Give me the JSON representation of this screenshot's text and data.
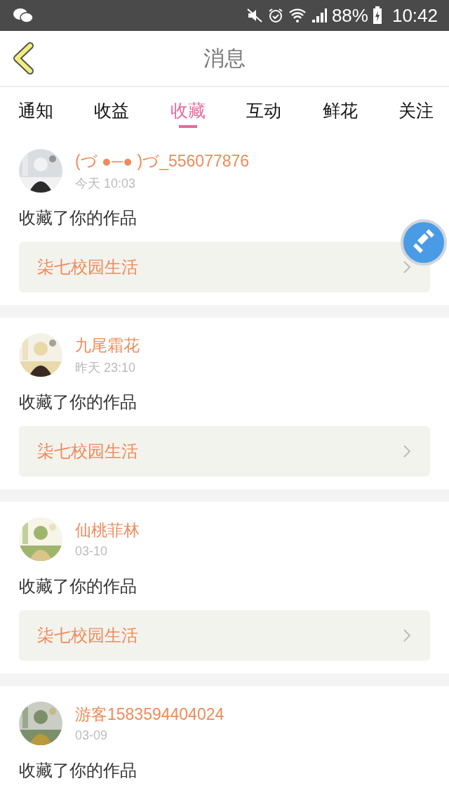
{
  "status_bar": {
    "battery": "88%",
    "time": "10:42"
  },
  "header": {
    "title": "消息"
  },
  "tabs": [
    {
      "label": "通知",
      "selected": false
    },
    {
      "label": "收益",
      "selected": false
    },
    {
      "label": "收藏",
      "selected": true
    },
    {
      "label": "互动",
      "selected": false
    },
    {
      "label": "鲜花",
      "selected": false
    },
    {
      "label": "关注",
      "selected": false
    }
  ],
  "messages": [
    {
      "user": "(づ ●─● )づ_556077876",
      "time": "今天 10:03",
      "action": "收藏了你的作品",
      "work": "柒七校园生活"
    },
    {
      "user": "九尾霜花",
      "time": "昨天 23:10",
      "action": "收藏了你的作品",
      "work": "柒七校园生活"
    },
    {
      "user": "仙桃菲林",
      "time": "03-10",
      "action": "收藏了你的作品",
      "work": "柒七校园生活"
    },
    {
      "user": "游客1583594404024",
      "time": "03-09",
      "action": "收藏了你的作品"
    }
  ]
}
